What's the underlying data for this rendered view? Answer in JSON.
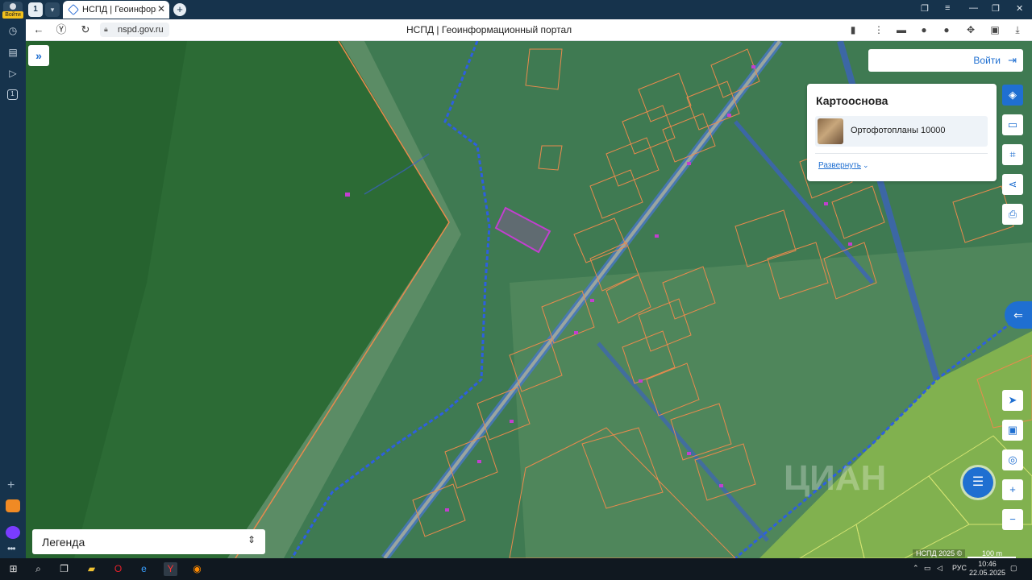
{
  "rail": {
    "avatar_label": "Войти",
    "tab_badge": "1"
  },
  "tabs": {
    "count": "1",
    "active_title": "НСПД | Геоинформаци"
  },
  "address": {
    "url": "nspd.gov.ru",
    "page_title": "НСПД | Геоинформационный портал"
  },
  "map": {
    "login_label": "Войти",
    "basemap": {
      "title": "Картооснова",
      "layer_name": "Ортофотопланы 10000",
      "expand_label": "Развернуть"
    },
    "legend_label": "Легенда",
    "watermark": "ЦИАН",
    "copyright": "НСПД 2025 ©",
    "scale_label": "100 m"
  },
  "taskbar": {
    "lang": "РУС",
    "time": "10:46",
    "date": "22.05.2025"
  },
  "colors": {
    "accent": "#1f6fd1",
    "parcel": "#e98a4d",
    "boundary": "#2d5fe0",
    "selected": "#c23fcf"
  }
}
